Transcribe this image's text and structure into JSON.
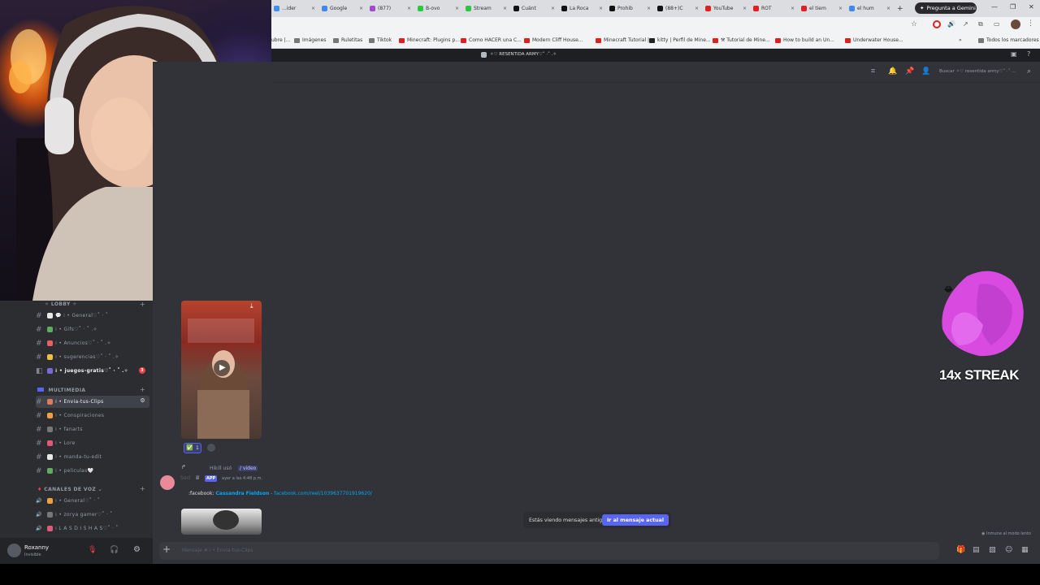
{
  "browser": {
    "tabs": [
      {
        "label": "...ider",
        "color": "#3c8ef0"
      },
      {
        "label": "Google",
        "color": "#4285f4"
      },
      {
        "label": "(877)",
        "color": "#a04ad0"
      },
      {
        "label": "B-ovo",
        "color": "#28c840"
      },
      {
        "label": "Stream",
        "color": "#28c840"
      },
      {
        "label": "Cuánt",
        "color": "#111111"
      },
      {
        "label": "La Roca",
        "color": "#111111"
      },
      {
        "label": "Prohib",
        "color": "#111111"
      },
      {
        "label": "(88+)C",
        "color": "#111111"
      },
      {
        "label": "YouTube",
        "color": "#e02020"
      },
      {
        "label": "ROT",
        "color": "#e02020"
      },
      {
        "label": "el tiem",
        "color": "#e02020"
      },
      {
        "label": "el hum",
        "color": "#4285f4"
      }
    ],
    "gemini_label": "Pregunta a Gemini",
    "bookmarks": [
      {
        "label": "Imágenes",
        "color": "#777777"
      },
      {
        "label": "Ruletitas",
        "color": "#777777"
      },
      {
        "label": "Tiktok",
        "color": "#777777"
      },
      {
        "label": "Minecraft: Plugins p...",
        "color": "#e02020"
      },
      {
        "label": "Como HACER una C...",
        "color": "#e02020"
      },
      {
        "label": "Modern Cliff House...",
        "color": "#e02020"
      },
      {
        "label": "Minecraft Tutorial |...",
        "color": "#e02020"
      },
      {
        "label": "kitty | Perfil de Mine...",
        "color": "#222222"
      },
      {
        "label": "⚒ Tutorial de Mine...",
        "color": "#e02020"
      },
      {
        "label": "How to build an Un...",
        "color": "#e02020"
      },
      {
        "label": "Underwater House...",
        "color": "#e02020"
      }
    ],
    "bookmarks_left_stub": "ubre |...",
    "all_bookmarks": "Todos los marcadores"
  },
  "discord": {
    "server_title": "✧♡ RESENTIDA ARMY♡˚ ·˚ .✧",
    "search_placeholder": "Buscar ✧♡ resentida army♡˚ ·˚ ...",
    "categories": {
      "lobby": "✧ LOBBY ✧",
      "multimedia": "MULTIMEDIA",
      "voice": "CANALES DE VOZ"
    },
    "channels_lobby": [
      {
        "name": "💬 ⁞ • General♡˚ · ˚",
        "kind": "text"
      },
      {
        "name": "⁞ • Gifs♡˚ · ˚ .✧",
        "kind": "text"
      },
      {
        "name": "⁞ • Anuncios♡˚ · ˚ .✧",
        "kind": "text"
      },
      {
        "name": "⁞ • sugerencias♡˚ · ˚ .✧",
        "kind": "text"
      },
      {
        "name": "⁞ • juegos-gratis♡˚ · ˚ .✧",
        "kind": "forum",
        "badge": "3"
      }
    ],
    "channels_media": [
      {
        "name": "⁞ • Envia-tus-Clips",
        "kind": "text",
        "selected": true
      },
      {
        "name": "⁞ • Conspiraciones",
        "kind": "text"
      },
      {
        "name": "⁞ • fanarts",
        "kind": "text"
      },
      {
        "name": "⁞ • Lore",
        "kind": "text"
      },
      {
        "name": "⁞ • manda-tu-edit",
        "kind": "text"
      },
      {
        "name": "⁞ • peliculas🤍",
        "kind": "text"
      }
    ],
    "channels_voice": [
      {
        "name": "⁞ • General♡˚ · ˚",
        "kind": "voice"
      },
      {
        "name": "⁞ • zorya gamer♡˚ · ˚",
        "kind": "voice"
      },
      {
        "name": "⁞ L A S D I S H A S♡˚ · ˚",
        "kind": "voice"
      }
    ],
    "reaction_count": "1",
    "message": {
      "header": "Hikill usó",
      "command": "/ video",
      "author": "Socl",
      "app_tag": "APP",
      "timestamp": "ayer a las 4:48 p.m.",
      "body_prefix": ":facebook:",
      "body_name": "Cassandra Fieldson",
      "body_link": "facebook.com/reel/1039637701919620/"
    },
    "old_messages_notice": "Estás viendo mensajes antiguos",
    "jump_button": "Ir al mensaje actual",
    "slowmode_notice": "Inmune al modo lento",
    "composer_placeholder": "Mensaje # ⁞ • Envia-tus-Clips",
    "user": {
      "name": "Roxanny",
      "status": "Invisible"
    }
  },
  "overlay": {
    "streak_text": "14x STREAK"
  },
  "colors": {
    "discord_bg": "#313338",
    "sidebar_bg": "#2b2d31",
    "blurple": "#5865f2",
    "link": "#00a8fc"
  }
}
